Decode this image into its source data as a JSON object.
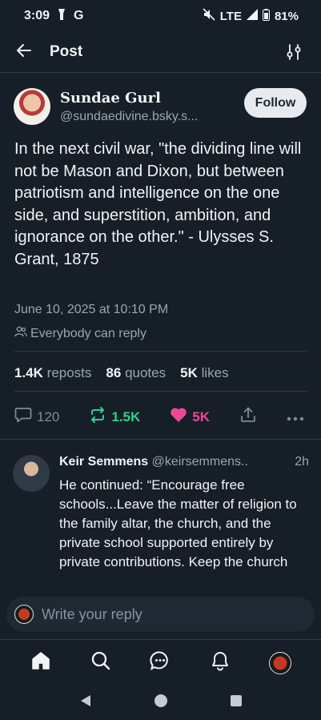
{
  "status_bar": {
    "time": "3:09",
    "network": "LTE",
    "battery": "81%"
  },
  "header": {
    "title": "Post"
  },
  "post": {
    "author_name": "Sundae Gurl",
    "author_handle": "@sundaedivine.bsky.s...",
    "follow_label": "Follow",
    "text": "In the next civil war, \"the dividing line will not be Mason and Dixon, but between patriotism and intelligence on the one side, and superstition, ambition, and ignorance on the other.\" - Ulysses S. Grant, 1875",
    "timestamp": "June 10, 2025 at 10:10 PM",
    "reply_permission": "Everybody can reply",
    "stats": {
      "reposts_count": "1.4K",
      "reposts_label": "reposts",
      "quotes_count": "86",
      "quotes_label": "quotes",
      "likes_count": "5K",
      "likes_label": "likes"
    },
    "actions": {
      "replies": "120",
      "reposts": "1.5K",
      "likes": "5K"
    }
  },
  "reply": {
    "author_name": "Keir Semmens",
    "author_handle": "@keirsemmens..",
    "time": "2h",
    "text": "He continued: “Encourage free schools...Leave the matter of religion to the family altar, the church, and the private school supported entirely by private contributions. Keep the church"
  },
  "composer": {
    "placeholder": "Write your reply"
  },
  "colors": {
    "background": "#161e27",
    "accent_repost": "#2fd18a",
    "accent_like": "#ec4899",
    "muted": "#9aa6b5"
  },
  "icons": {
    "header": [
      "back-arrow-icon",
      "filter-icon"
    ],
    "tabs": [
      "home-icon",
      "search-icon",
      "chat-icon",
      "bell-icon",
      "profile-avatar"
    ]
  }
}
